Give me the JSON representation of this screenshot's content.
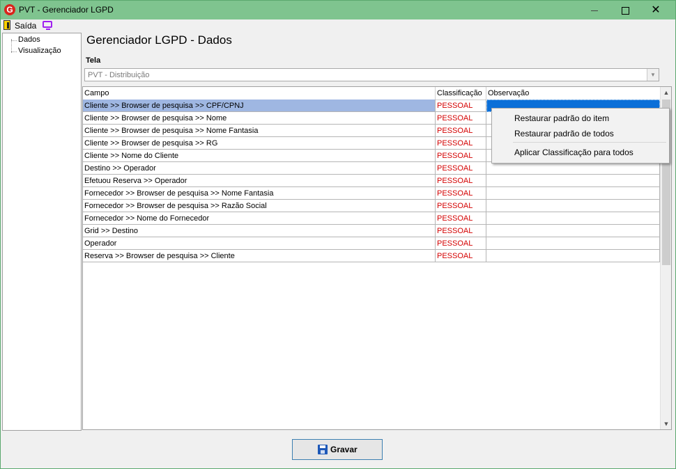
{
  "window": {
    "logo_letter": "G",
    "title": "PVT - Gerenciador LGPD",
    "minimize": "",
    "maximize": "",
    "close": "✕"
  },
  "toolbar": {
    "exit_label": "Saída"
  },
  "tree": {
    "items": [
      "Dados",
      "Visualização"
    ]
  },
  "main": {
    "title": "Gerenciador LGPD - Dados",
    "tela_label": "Tela",
    "tela_value": "PVT - Distribuição"
  },
  "grid": {
    "headers": [
      "Campo",
      "Classificação",
      "Observação"
    ],
    "rows": [
      {
        "campo": "Cliente >> Browser de pesquisa >> CPF/CPNJ",
        "classificacao": "PESSOAL",
        "observacao": ""
      },
      {
        "campo": "Cliente >> Browser de pesquisa >> Nome",
        "classificacao": "PESSOAL",
        "observacao": ""
      },
      {
        "campo": "Cliente >> Browser de pesquisa >> Nome Fantasia",
        "classificacao": "PESSOAL",
        "observacao": ""
      },
      {
        "campo": "Cliente >> Browser de pesquisa >> RG",
        "classificacao": "PESSOAL",
        "observacao": ""
      },
      {
        "campo": "Cliente >> Nome do Cliente",
        "classificacao": "PESSOAL",
        "observacao": ""
      },
      {
        "campo": "Destino >> Operador",
        "classificacao": "PESSOAL",
        "observacao": ""
      },
      {
        "campo": "Efetuou Reserva >> Operador",
        "classificacao": "PESSOAL",
        "observacao": ""
      },
      {
        "campo": "Fornecedor >> Browser de pesquisa >> Nome Fantasia",
        "classificacao": "PESSOAL",
        "observacao": ""
      },
      {
        "campo": "Fornecedor >> Browser de pesquisa >> Razão Social",
        "classificacao": "PESSOAL",
        "observacao": ""
      },
      {
        "campo": "Fornecedor >> Nome do Fornecedor",
        "classificacao": "PESSOAL",
        "observacao": ""
      },
      {
        "campo": "Grid >> Destino",
        "classificacao": "PESSOAL",
        "observacao": ""
      },
      {
        "campo": "Operador",
        "classificacao": "PESSOAL",
        "observacao": ""
      },
      {
        "campo": "Reserva >> Browser de pesquisa >> Cliente",
        "classificacao": "PESSOAL",
        "observacao": ""
      }
    ]
  },
  "context_menu": {
    "items": [
      "Restaurar padrão do item",
      "Restaurar padrão de todos",
      "Aplicar Classificação para todos"
    ]
  },
  "footer": {
    "save_label": "Gravar"
  },
  "colors": {
    "titlebar": "#7fc48f",
    "selected_row": "#9fb7e2",
    "selected_cell": "#0b6fd8",
    "classification_text": "#d40000"
  }
}
